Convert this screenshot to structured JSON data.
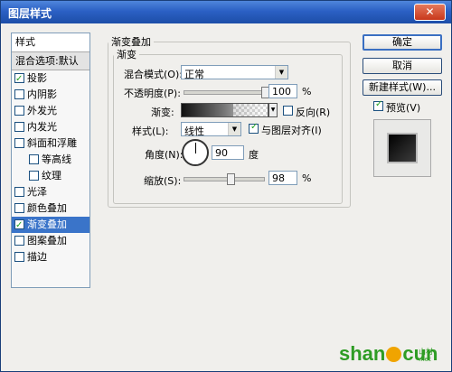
{
  "window": {
    "title": "图层样式",
    "close_glyph": "✕"
  },
  "styles": {
    "header": "样式",
    "blending": "混合选项:默认",
    "items": [
      {
        "label": "投影",
        "checked": true
      },
      {
        "label": "内阴影",
        "checked": false
      },
      {
        "label": "外发光",
        "checked": false
      },
      {
        "label": "内发光",
        "checked": false
      },
      {
        "label": "斜面和浮雕",
        "checked": false
      },
      {
        "label": "等高线",
        "checked": false,
        "sub": true
      },
      {
        "label": "纹理",
        "checked": false,
        "sub": true
      },
      {
        "label": "光泽",
        "checked": false
      },
      {
        "label": "颜色叠加",
        "checked": false
      },
      {
        "label": "渐变叠加",
        "checked": true,
        "selected": true
      },
      {
        "label": "图案叠加",
        "checked": false
      },
      {
        "label": "描边",
        "checked": false
      }
    ]
  },
  "panel": {
    "outer_title": "渐变叠加",
    "inner_title": "渐变",
    "blend_mode_label": "混合模式(O):",
    "blend_mode_value": "正常",
    "opacity_label": "不透明度(P):",
    "opacity_value": "100",
    "opacity_unit": "%",
    "opacity_level": 1.0,
    "gradient_label": "渐变:",
    "reverse_label": "反向(R)",
    "style_label": "样式(L):",
    "style_value": "线性",
    "align_label": "与图层对齐(I)",
    "angle_label": "角度(N):",
    "angle_value": "90",
    "angle_unit": "度",
    "scale_label": "缩放(S):",
    "scale_value": "98",
    "scale_unit": "%"
  },
  "buttons": {
    "ok": "确定",
    "cancel": "取消",
    "new_style": "新建样式(W)...",
    "preview": "预览(V)"
  },
  "watermark": {
    "main_a": "shan",
    "main_b": "cun",
    "suffix": ".net",
    "cn": "山村"
  }
}
